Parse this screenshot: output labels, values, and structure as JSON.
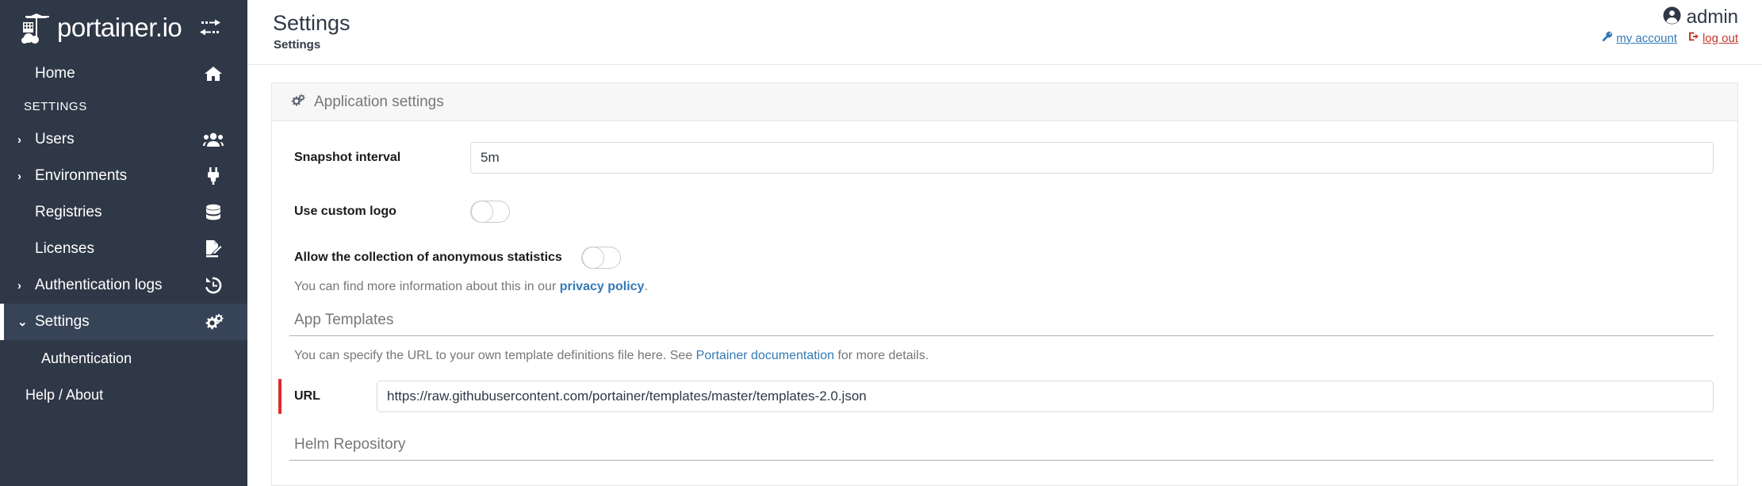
{
  "brand": {
    "name": "portainer.io",
    "logo_icon": "portainer-crane-logo",
    "toggle_icon": "exchange-arrows-icon"
  },
  "sidebar": {
    "home": {
      "label": "Home",
      "icon": "home-icon"
    },
    "section_label": "SETTINGS",
    "items": [
      {
        "label": "Users",
        "icon": "users-icon",
        "caret": "›",
        "expandable": true,
        "active": false
      },
      {
        "label": "Environments",
        "icon": "plug-icon",
        "caret": "›",
        "expandable": true,
        "active": false
      },
      {
        "label": "Registries",
        "icon": "database-icon",
        "caret": "",
        "expandable": false,
        "active": false
      },
      {
        "label": "Licenses",
        "icon": "file-signature-icon",
        "caret": "",
        "expandable": false,
        "active": false
      },
      {
        "label": "Authentication logs",
        "icon": "history-icon",
        "caret": "›",
        "expandable": true,
        "active": false
      },
      {
        "label": "Settings",
        "icon": "gears-icon",
        "caret": "⌄",
        "expandable": true,
        "active": true
      }
    ],
    "sub_items": [
      {
        "label": "Authentication"
      }
    ],
    "footer_items": [
      {
        "label": "Help / About"
      }
    ]
  },
  "header": {
    "title": "Settings",
    "breadcrumb": "Settings",
    "user": {
      "name": "admin",
      "avatar_icon": "user-circle-icon",
      "my_account_label": "my account",
      "my_account_icon": "wrench-icon",
      "logout_label": "log out",
      "logout_icon": "sign-out-icon"
    }
  },
  "panel": {
    "title": "Application settings",
    "icon": "gears-icon"
  },
  "form": {
    "snapshot_interval": {
      "label": "Snapshot interval",
      "value": "5m",
      "placeholder": "5m"
    },
    "use_custom_logo": {
      "label": "Use custom logo",
      "enabled": false
    },
    "anonymous_statistics": {
      "label": "Allow the collection of anonymous statistics",
      "enabled": false
    },
    "privacy_note": {
      "prefix": "You can find more information about this in our ",
      "link": "privacy policy",
      "suffix": "."
    },
    "app_templates": {
      "section_title": "App Templates",
      "description_prefix": "You can specify the URL to your own template definitions file here. See ",
      "description_link": "Portainer documentation",
      "description_suffix": " for more details.",
      "url_label": "URL",
      "url_value": "https://raw.githubusercontent.com/portainer/templates/master/templates-2.0.json",
      "url_placeholder": "https://raw.githubusercontent.com/portainer/templates/master/templates-2.0.json",
      "has_validation_indicator": true
    },
    "helm_repository": {
      "section_title": "Helm Repository"
    }
  },
  "colors": {
    "sidebar_bg": "#2f3847",
    "sidebar_active_bg": "#374357",
    "link_blue": "#337ab7",
    "logout_red": "#c0392b",
    "indicator_red": "#e02a2a",
    "panel_head_bg": "#f7f7f7"
  }
}
